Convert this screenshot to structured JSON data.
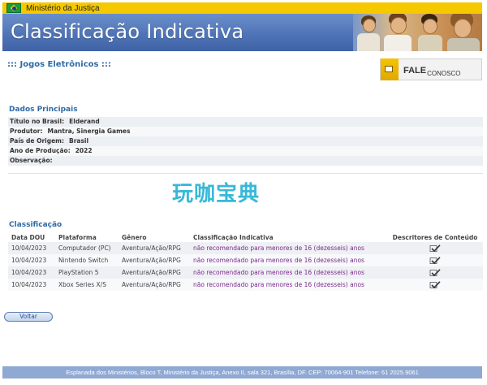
{
  "gov_bar": {
    "ministry": "Ministério da Justiça",
    "flag_icon": "brazil-flag-icon"
  },
  "banner": {
    "title": "Classificação Indicativa",
    "accent": "#4d72b5"
  },
  "section": {
    "title": "::: Jogos Eletrônicos :::"
  },
  "fale": {
    "big": "FALE",
    "small": "CONOSCO",
    "icon": "megaphone-icon"
  },
  "dados": {
    "heading": "Dados Principais",
    "rows": [
      {
        "label": "Título no Brasil:",
        "value": "Elderand"
      },
      {
        "label": "Produtor:",
        "value": "Mantra, Sinergia Games"
      },
      {
        "label": "País de Origem:",
        "value": "Brasil"
      },
      {
        "label": "Ano de Produção:",
        "value": "2022"
      },
      {
        "label": "Observação:",
        "value": ""
      }
    ]
  },
  "watermark": "玩咖宝典",
  "classificacao": {
    "heading": "Classificação",
    "columns": [
      "Data DOU",
      "Plataforma",
      "Gênero",
      "Classificação Indicativa",
      "Descritores de Conteúdo"
    ],
    "rows": [
      {
        "data": "10/04/2023",
        "plataforma": "Computador (PC)",
        "genero": "Aventura/Ação/RPG",
        "classificacao": "não recomendado para menores de 16 (dezesseis) anos",
        "descritor_icon": "checklist-icon"
      },
      {
        "data": "10/04/2023",
        "plataforma": "Nintendo Switch",
        "genero": "Aventura/Ação/RPG",
        "classificacao": "não recomendado para menores de 16 (dezesseis) anos",
        "descritor_icon": "checklist-icon"
      },
      {
        "data": "10/04/2023",
        "plataforma": "PlayStation 5",
        "genero": "Aventura/Ação/RPG",
        "classificacao": "não recomendado para menores de 16 (dezesseis) anos",
        "descritor_icon": "checklist-icon"
      },
      {
        "data": "10/04/2023",
        "plataforma": "Xbox Series X/S",
        "genero": "Aventura/Ação/RPG",
        "classificacao": "não recomendado para menores de 16 (dezesseis) anos",
        "descritor_icon": "checklist-icon"
      }
    ],
    "rating_color": "#7b2b8c"
  },
  "buttons": {
    "voltar": "Voltar"
  },
  "footer": {
    "address": "Esplanada dos Ministérios, Bloco T, Ministério da Justiça, Anexo II, sala 321, Brasília, DF. CEP: 70064-901 Telefone: 61 2025.9061"
  }
}
